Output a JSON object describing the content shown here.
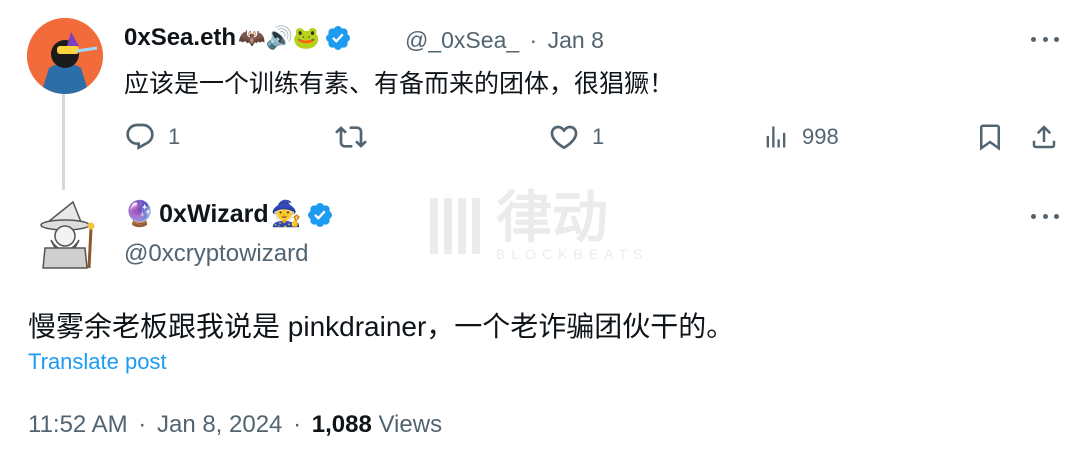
{
  "reply": {
    "display_name": "0xSea.eth",
    "name_emojis": "🦇🔊🐸",
    "handle": "@_0xSea_",
    "separator": "·",
    "date": "Jan 8",
    "text": "应该是一个训练有素、有备而来的团体，很猖獗！",
    "actions": {
      "replies": "1",
      "reposts": "",
      "likes": "1",
      "views": "998"
    }
  },
  "tweet": {
    "badge_emoji": "🔮",
    "display_name": "0xWizard",
    "wizard_emoji": "🧙",
    "handle": "@0xcryptowizard",
    "text": "慢雾余老板跟我说是 pinkdrainer，一个老诈骗团伙干的。",
    "translate_label": "Translate post",
    "time": "11:52 AM",
    "separator": "·",
    "date": "Jan 8, 2024",
    "views_count": "1,088",
    "views_label": "Views"
  },
  "watermark": {
    "text": "律动",
    "subtext": "BLOCKBEATS"
  },
  "colors": {
    "accent": "#1d9bf0",
    "muted": "#536471",
    "thread_line": "#cfd9de"
  }
}
